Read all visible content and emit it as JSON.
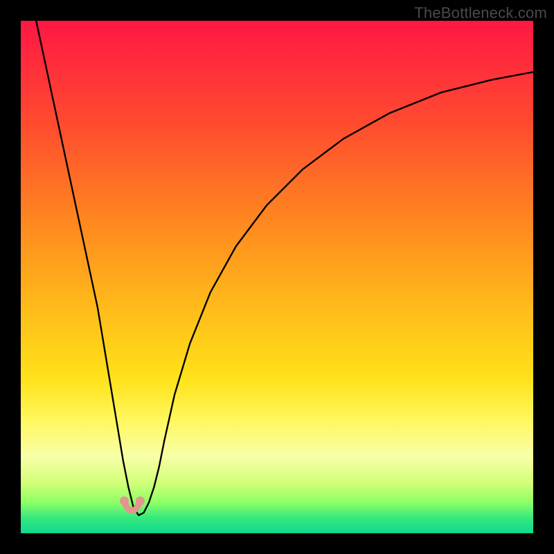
{
  "watermark": "TheBottleneck.com",
  "chart_data": {
    "type": "line",
    "title": "",
    "xlabel": "",
    "ylabel": "",
    "xlim": [
      0,
      100
    ],
    "ylim": [
      0,
      100
    ],
    "gradient_stops": [
      {
        "offset": 0.0,
        "color": "#ff1744"
      },
      {
        "offset": 0.2,
        "color": "#ff4b2f"
      },
      {
        "offset": 0.4,
        "color": "#ff8a1f"
      },
      {
        "offset": 0.55,
        "color": "#ffb81a"
      },
      {
        "offset": 0.7,
        "color": "#ffe21a"
      },
      {
        "offset": 0.78,
        "color": "#fff85e"
      },
      {
        "offset": 0.85,
        "color": "#f8ffa8"
      },
      {
        "offset": 0.9,
        "color": "#d4ff7a"
      },
      {
        "offset": 0.94,
        "color": "#8eff66"
      },
      {
        "offset": 0.97,
        "color": "#36e97e"
      },
      {
        "offset": 1.0,
        "color": "#0fd890"
      }
    ],
    "series": [
      {
        "name": "bottleneck-curve",
        "color": "#000000",
        "width": 2.4,
        "x": [
          3.0,
          4.5,
          6.0,
          7.5,
          9.0,
          10.5,
          12.0,
          13.5,
          15.0,
          16.0,
          17.0,
          18.0,
          19.0,
          20.0,
          21.0,
          22.0,
          23.0,
          24.0,
          25.0,
          26.0,
          27.0,
          28.0,
          30.0,
          33.0,
          37.0,
          42.0,
          48.0,
          55.0,
          63.0,
          72.0,
          82.0,
          92.0,
          100.0
        ],
        "y": [
          100.0,
          93.0,
          86.0,
          79.0,
          72.0,
          65.0,
          58.0,
          51.0,
          44.0,
          38.0,
          32.0,
          26.0,
          20.0,
          14.0,
          9.0,
          5.0,
          3.5,
          4.0,
          6.0,
          9.0,
          13.0,
          18.0,
          27.0,
          37.0,
          47.0,
          56.0,
          64.0,
          71.0,
          77.0,
          82.0,
          86.0,
          88.5,
          90.0
        ]
      }
    ],
    "markers": {
      "name": "near-zero-dots",
      "color": "#e2968f",
      "radius_outer": 6.5,
      "radius_inner": 5.2,
      "points": [
        {
          "x": 20.2,
          "y": 6.3
        },
        {
          "x": 23.3,
          "y": 6.3
        }
      ],
      "bridge": {
        "color": "#e2968f",
        "width": 9,
        "x": [
          20.2,
          20.6,
          21.1,
          21.7,
          22.3,
          22.8,
          23.3
        ],
        "y": [
          6.3,
          5.2,
          4.6,
          4.4,
          4.6,
          5.2,
          6.3
        ]
      }
    }
  }
}
